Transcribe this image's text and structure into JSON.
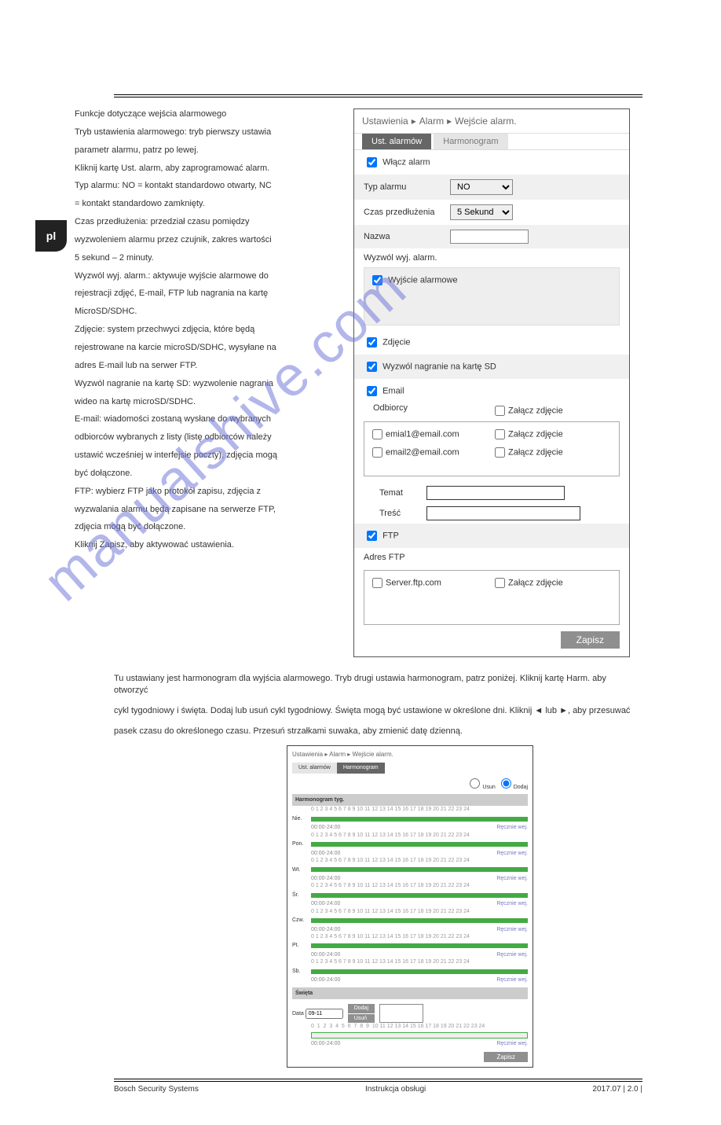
{
  "lang_tab": "pl",
  "breadcrumb": {
    "a": "Ustawienia",
    "b": "Alarm",
    "c": "Wejście alarm."
  },
  "tabs": {
    "active": "Ust. alarmów",
    "inactive": "Harmonogram"
  },
  "enable_alarm": "Włącz alarm",
  "alarm_type": {
    "label": "Typ alarmu",
    "value": "NO"
  },
  "hold_time": {
    "label": "Czas przedłużenia",
    "value": "5 Sekund"
  },
  "name": {
    "label": "Nazwa",
    "value": ""
  },
  "trigger_out": "Wyzwól wyj. alarm.",
  "alarm_out": "Wyjście alarmowe",
  "snapshot": "Zdjęcie",
  "trigger_sd": "Wyzwól nagranie na kartę SD",
  "email": "Email",
  "recipients_label": "Odbiorcy",
  "attach_pic": "Załącz zdjęcie",
  "email1": "emial1@email.com",
  "email2": "email2@email.com",
  "subject": {
    "label": "Temat"
  },
  "content": {
    "label": "Treść"
  },
  "ftp": "FTP",
  "ftp_addr": "Adres FTP",
  "ftp_server": "Server.ftp.com",
  "save": "Zapisz",
  "sched": {
    "tab_a": "Ust. alarmów",
    "tab_b": "Harmonogram",
    "mode": {
      "erase": "Usun",
      "add": "Dodaj"
    },
    "weekly": "Harmonogram tyg.",
    "days": [
      "Nie.",
      "Pon.",
      "Wt.",
      "Śr.",
      "Czw.",
      "Pt.",
      "Sb."
    ],
    "range": "00:00-24:00",
    "manual": "Ręcznie wej.",
    "holiday": "Święta",
    "date_label": "Data",
    "date_val": "09-11",
    "add": "Dodaj",
    "del": "Usuń",
    "save": "Zapisz"
  },
  "footer": {
    "left": "Bosch Security Systems",
    "mid": "Instrukcja obsługi",
    "right": "2017.07 | 2.0 |"
  },
  "text": {
    "t1": "Funkcje dotyczące wejścia alarmowego",
    "t2": "Tryb ustawienia alarmowego: tryb pierwszy ustawia",
    "t3": "parametr alarmu, patrz po lewej.",
    "t4": "Kliknij kartę Ust. alarm, aby zaprogramować alarm.",
    "t5": "Typ alarmu: NO = kontakt standardowo otwarty, NC",
    "t6": "= kontakt standardowo zamknięty.",
    "t7": "Czas przedłużenia: przedział czasu pomiędzy",
    "t8": "wyzwoleniem alarmu przez czujnik, zakres wartości",
    "t9": "5 sekund – 2 minuty.",
    "t10": "Wyzwól wyj. alarm.: aktywuje wyjście alarmowe do",
    "t11": "rejestracji zdjęć, E-mail, FTP lub nagrania na kartę",
    "t12": "MicroSD/SDHC.",
    "t13": "Zdjęcie: system przechwyci zdjęcia, które będą",
    "t14": "rejestrowane na karcie microSD/SDHC, wysyłane na",
    "t15": "adres E-mail lub na serwer FTP.",
    "t16": "Wyzwól nagranie na kartę SD: wyzwolenie nagrania",
    "t17": "wideo na kartę microSD/SDHC.",
    "t18": "E-mail: wiadomości zostaną wysłane do wybranych",
    "t19": "odbiorców wybranych z listy (listę odbiorców należy",
    "t20": "ustawić wcześniej w interfejsie poczty), zdjęcia mogą",
    "t21": "być dołączone.",
    "t22": "FTP: wybierz FTP jako protokół zapisu, zdjęcia z",
    "t23": "wyzwalania alarmu będą zapisane na serwerze FTP,",
    "t24": "zdjęcia mogą być dołączone.",
    "t25": "Kliknij Zapisz, aby aktywować ustawienia.",
    "b1": "Tu ustawiany jest harmonogram dla wyjścia alarmowego. Tryb drugi ustawia harmonogram, patrz poniżej. Kliknij kartę Harm. aby otworzyć",
    "b2": "cykl tygodniowy i święta. Dodaj lub usuń cykl tygodniowy. Święta mogą być ustawione w określone dni. Kliknij ◄ lub ►, aby przesuwać",
    "b3": "pasek czasu do określonego czasu. Przesuń strzałkami suwaka, aby zmienić datę dzienną."
  }
}
